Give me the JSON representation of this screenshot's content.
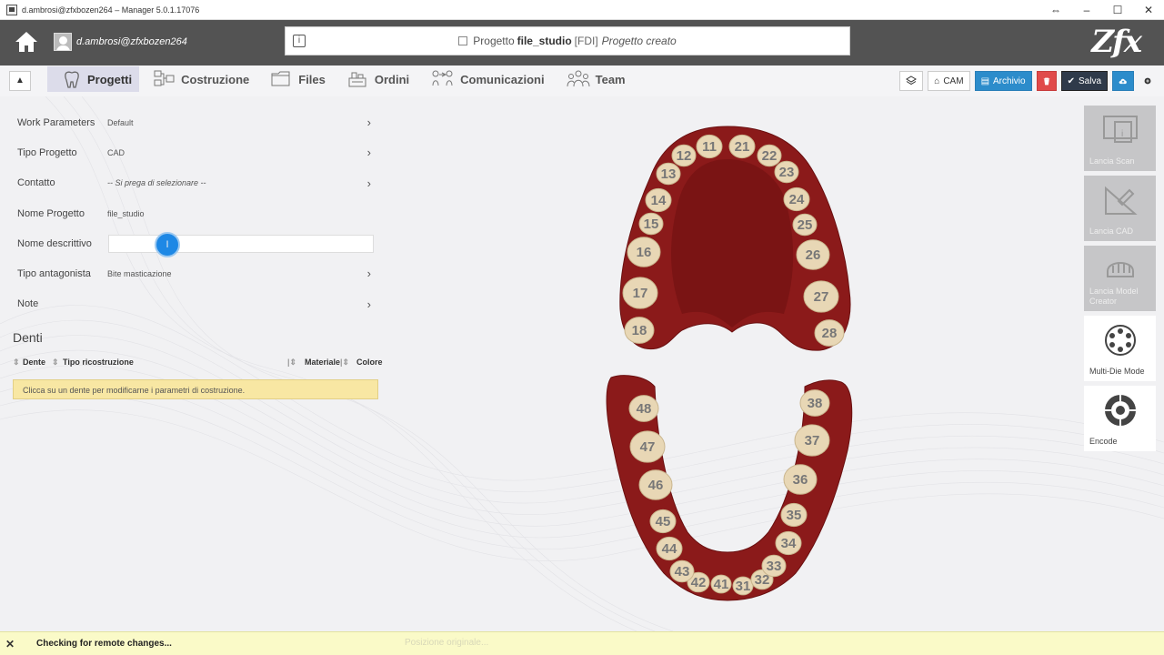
{
  "window": {
    "title": "d.ambrosi@zfxbozen264 – Manager 5.0.1.17076"
  },
  "header": {
    "user": "d.ambrosi@zfxbozen264",
    "project_prefix": "Progetto",
    "project_name": "file_studio",
    "project_system": "[FDI]",
    "project_status": "Progetto creato",
    "logo": "Zfx"
  },
  "tabs": [
    {
      "label": "Progetti",
      "icon": "tooth-icon",
      "active": true
    },
    {
      "label": "Costruzione",
      "icon": "construction-icon"
    },
    {
      "label": "Files",
      "icon": "folder-icon"
    },
    {
      "label": "Ordini",
      "icon": "orders-icon"
    },
    {
      "label": "Comunicazioni",
      "icon": "communications-icon"
    },
    {
      "label": "Team",
      "icon": "team-icon"
    }
  ],
  "actions": {
    "cam": "CAM",
    "archivio": "Archivio",
    "salva": "Salva"
  },
  "form": {
    "work_parameters": {
      "label": "Work Parameters",
      "value": "Default"
    },
    "tipo_progetto": {
      "label": "Tipo Progetto",
      "value": "CAD"
    },
    "contatto": {
      "label": "Contatto",
      "value": "-- Si prega di selezionare --"
    },
    "nome_progetto": {
      "label": "Nome Progetto",
      "value": "file_studio"
    },
    "nome_descrittivo": {
      "label": "Nome descrittivo",
      "value": ""
    },
    "tipo_antagonista": {
      "label": "Tipo antagonista",
      "value": "Bite masticazione"
    },
    "note": {
      "label": "Note",
      "value": ""
    }
  },
  "denti": {
    "title": "Denti",
    "columns": [
      "Dente",
      "Tipo ricostruzione",
      "Materiale",
      "Colore"
    ],
    "notice": "Clicca su un dente per modificarne i parametri di costruzione."
  },
  "teeth": {
    "upper": [
      "11",
      "12",
      "13",
      "14",
      "15",
      "16",
      "17",
      "18",
      "21",
      "22",
      "23",
      "24",
      "25",
      "26",
      "27",
      "28"
    ],
    "lower": [
      "31",
      "32",
      "33",
      "34",
      "35",
      "36",
      "37",
      "38",
      "41",
      "42",
      "43",
      "44",
      "45",
      "46",
      "47",
      "48"
    ]
  },
  "side_buttons": [
    {
      "label": "Lancia Scan",
      "style": "gray",
      "icon": "scan-icon"
    },
    {
      "label": "Lancia CAD",
      "style": "gray",
      "icon": "cad-icon"
    },
    {
      "label": "Lancia Model Creator",
      "style": "gray",
      "icon": "model-creator-icon"
    },
    {
      "label": "Multi-Die Mode",
      "style": "white",
      "icon": "multi-die-icon"
    },
    {
      "label": "Encode",
      "style": "white",
      "icon": "encode-icon"
    }
  ],
  "status": {
    "message": "Checking for remote changes...",
    "ghost": "Posizione originale..."
  },
  "colors": {
    "header": "#535353",
    "gum": "#8b1a1a",
    "tooth": "#e8d7b5",
    "accent": "#2c8ccb"
  }
}
